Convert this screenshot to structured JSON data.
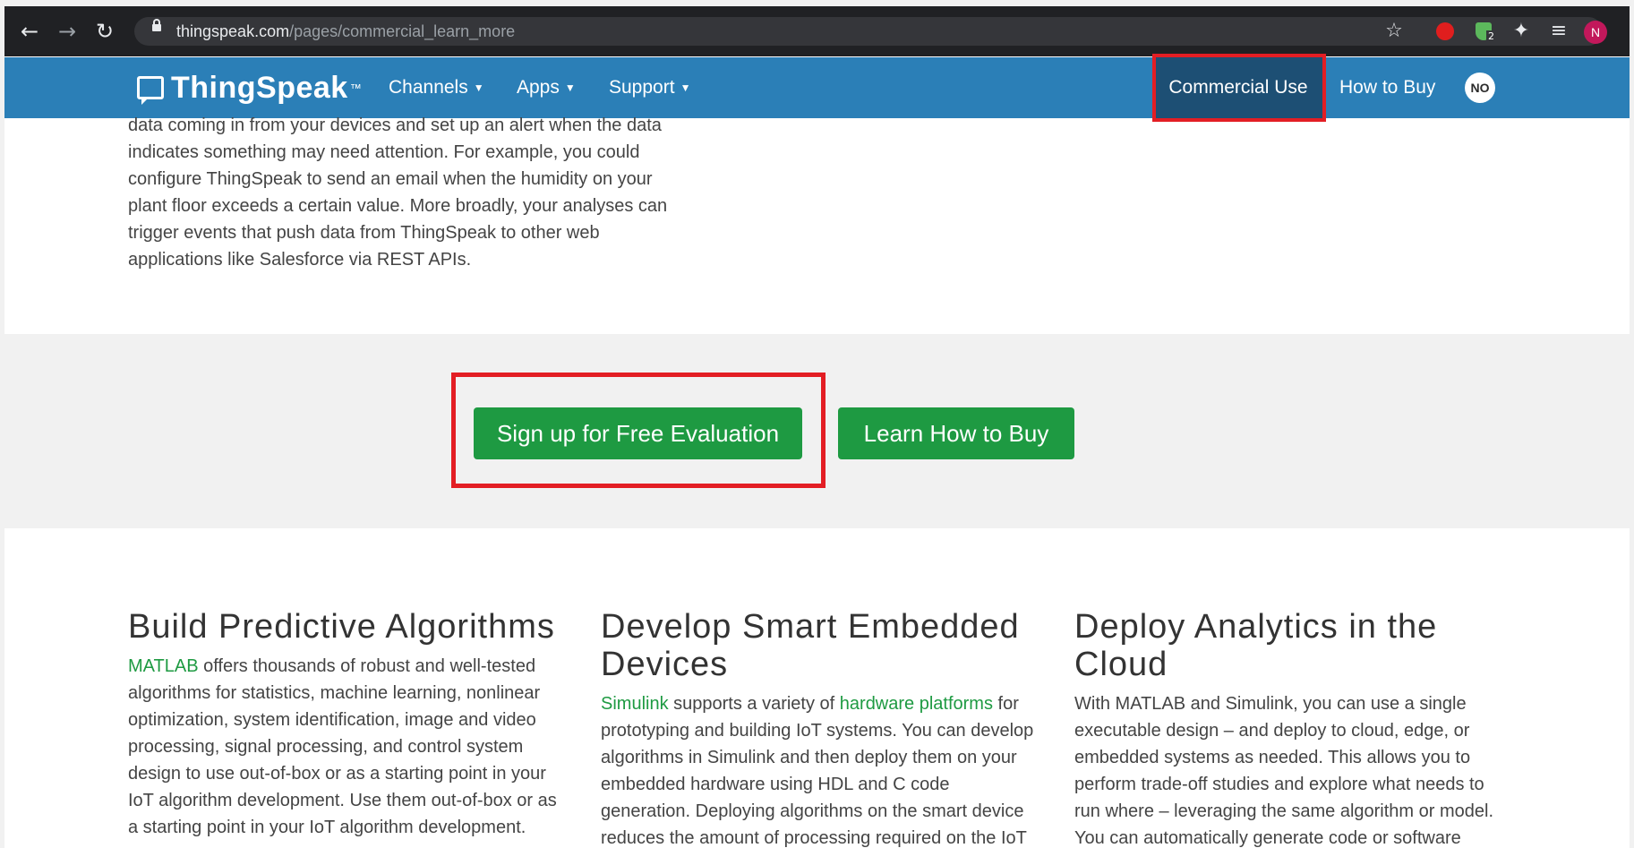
{
  "browser": {
    "url_domain": "thingspeak.com",
    "url_path": "/pages/commercial_learn_more",
    "profile_initial": "N",
    "extension_badge": "2"
  },
  "site_nav": {
    "logo": "ThingSpeak",
    "logo_tm": "™",
    "channels": "Channels",
    "apps": "Apps",
    "support": "Support",
    "commercial_use": "Commercial Use",
    "how_to_buy": "How to Buy",
    "user_badge": "NO"
  },
  "intro_text": "data coming in from your devices and set up an alert when the data indicates something may need attention. For example, you could configure ThingSpeak to send an email when the humidity on your plant floor exceeds a certain value. More broadly, your analyses can trigger events that push data from ThingSpeak to other web applications like Salesforce via REST APIs.",
  "cta": {
    "signup": "Sign up for Free Evaluation",
    "learn_buy": "Learn How to Buy"
  },
  "columns": [
    {
      "title": "Build Predictive Algorithms",
      "link1": "MATLAB",
      "text": " offers thousands of robust and well-tested algorithms for statistics, machine learning, nonlinear optimization, system identification, image and video processing, signal processing, and control system design to use out-of-box or as a starting point in your IoT algorithm development. Use them out-of-box or as a starting point in your IoT algorithm development."
    },
    {
      "title": "Develop Smart Embedded Devices",
      "link1": "Simulink",
      "text_mid": " supports a variety of ",
      "link2": "hardware platforms",
      "text": " for prototyping and building IoT systems. You can develop algorithms in Simulink and then deploy them on your embedded hardware using HDL and C code generation. Deploying algorithms on the smart device reduces the amount of processing required on the IoT"
    },
    {
      "title": "Deploy Analytics in the Cloud",
      "text": "With MATLAB and Simulink, you can use a single executable design – and deploy to cloud, edge, or embedded systems as needed. This allows you to perform trade-off studies and explore what needs to run where – leveraging the same algorithm or model. You can automatically generate code or software"
    }
  ]
}
